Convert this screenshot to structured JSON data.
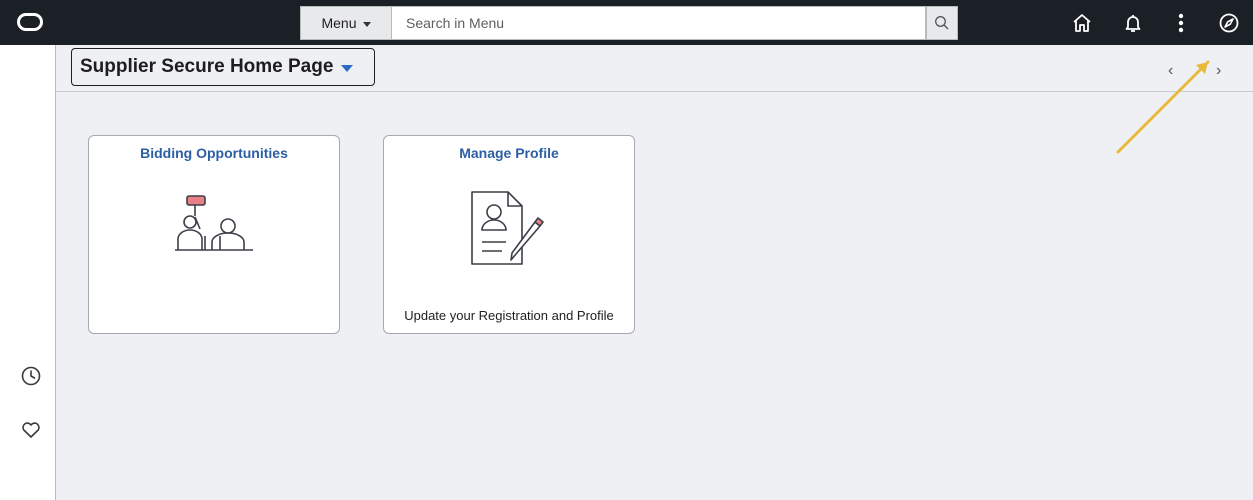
{
  "header": {
    "menu_label": "Menu",
    "search_placeholder": "Search in Menu",
    "icons": [
      "logo-icon",
      "search-icon",
      "home-icon",
      "bell-icon",
      "more-vert-icon",
      "compass-icon"
    ]
  },
  "sidebar": {
    "icons": [
      "recent-clock-icon",
      "favorites-heart-icon"
    ]
  },
  "page": {
    "title": "Supplier Secure Home Page"
  },
  "tiles": [
    {
      "title": "Bidding Opportunities",
      "description": ""
    },
    {
      "title": "Manage Profile",
      "description": "Update your Registration and Profile"
    }
  ],
  "colors": {
    "topbar": "#1b1f26",
    "content_bg": "#eff0f4",
    "tile_title": "#2c5ea4",
    "annotation_arrow": "#e8b93a"
  }
}
